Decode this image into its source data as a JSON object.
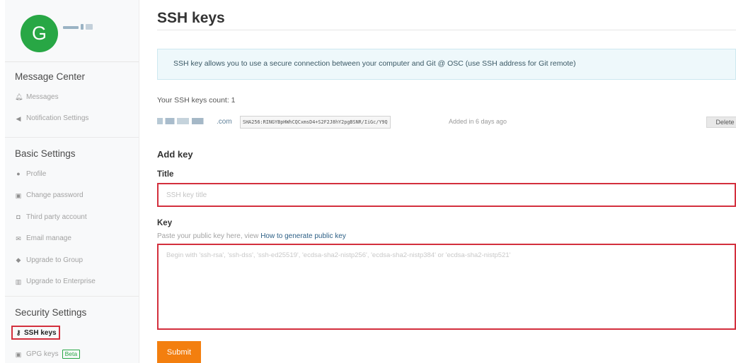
{
  "user": {
    "avatar_letter": "G"
  },
  "sidebar": {
    "message_center": {
      "title": "Message Center",
      "items": [
        {
          "label": "Messages",
          "icon": "bell-icon",
          "glyph": "🔔︎"
        },
        {
          "label": "Notification Settings",
          "icon": "megaphone-icon",
          "glyph": "◀"
        }
      ]
    },
    "basic_settings": {
      "title": "Basic Settings",
      "items": [
        {
          "label": "Profile",
          "icon": "user-icon",
          "glyph": "●"
        },
        {
          "label": "Change password",
          "icon": "lock-icon",
          "glyph": "▣"
        },
        {
          "label": "Third party account",
          "icon": "id-card-icon",
          "glyph": "◘"
        },
        {
          "label": "Email manage",
          "icon": "envelope-icon",
          "glyph": "✉"
        },
        {
          "label": "Upgrade to Group",
          "icon": "group-icon",
          "glyph": "◆"
        },
        {
          "label": "Upgrade to Enterprise",
          "icon": "building-icon",
          "glyph": "▥"
        }
      ]
    },
    "security_settings": {
      "title": "Security Settings",
      "ssh_keys": {
        "label": "SSH keys",
        "icon": "key-icon",
        "glyph": "⚷"
      },
      "gpg_keys": {
        "label": "GPG keys",
        "icon": "lock-icon",
        "glyph": "▣",
        "badge": "Beta"
      }
    }
  },
  "main": {
    "title": "SSH keys",
    "info": "SSH key allows you to use a secure connection between your computer and Git @ OSC (use SSH address for Git remote)",
    "count_text": "Your SSH keys count: 1",
    "key": {
      "email_suffix": ".com",
      "fingerprint": "SHA256:RINGYBpHWhCQCxmsD4+S2F2J8hY2pgBSNR/IiGc/Y9Q",
      "added": "Added in 6 days ago",
      "delete_label": "Delete"
    },
    "add_key": {
      "heading": "Add key",
      "title_label": "Title",
      "title_placeholder": "SSH key title",
      "key_label": "Key",
      "key_hint": "Paste your public key here, view",
      "key_hint_link": "How to generate public key",
      "key_placeholder": "Begin with 'ssh-rsa', 'ssh-dss', 'ssh-ed25519', 'ecdsa-sha2-nistp256', 'ecdsa-sha2-nistp384' or 'ecdsa-sha2-nistp521'",
      "submit_label": "Submit"
    }
  },
  "colors": {
    "accent_orange": "#f37f0f",
    "avatar_green": "#28a745",
    "highlight_red": "#d32f3d",
    "link_blue": "#2c5f85"
  }
}
